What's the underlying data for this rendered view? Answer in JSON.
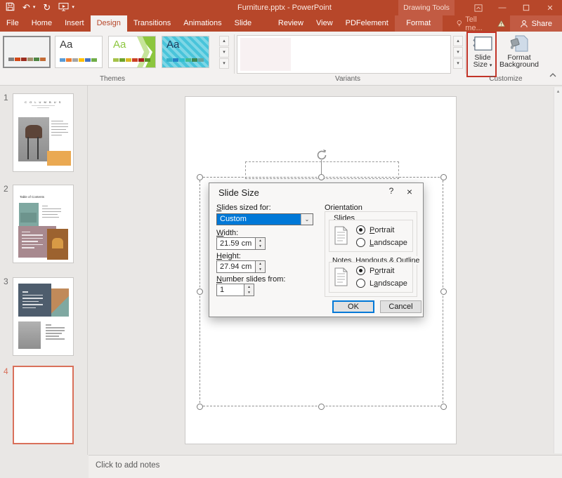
{
  "titlebar": {
    "title": "Furniture.pptx - PowerPoint",
    "contextual_label": "Drawing Tools"
  },
  "icons": {
    "undo_glyph": "↶",
    "redo_glyph": "↻",
    "qat_caret": "▾",
    "min_glyph": "—",
    "close_glyph": "✕",
    "up_arrow": "▴",
    "down_arrow": "▾",
    "chevron_down": "⌄",
    "collapse_chevron": "⌃"
  },
  "tabs": {
    "items": [
      {
        "label": "File"
      },
      {
        "label": "Home"
      },
      {
        "label": "Insert"
      },
      {
        "label": "Design"
      },
      {
        "label": "Transitions"
      },
      {
        "label": "Animations"
      },
      {
        "label": "Slide Show"
      },
      {
        "label": "Review"
      },
      {
        "label": "View"
      },
      {
        "label": "PDFelement"
      }
    ],
    "contextual_tab": "Format",
    "tell_me": "Tell me...",
    "share": "Share"
  },
  "ribbon": {
    "themes": {
      "label": "Themes",
      "aa": "Aa",
      "theme1_swatches": [
        "#7f7f7f",
        "#d34817",
        "#9b2d1f",
        "#a28e6a",
        "#4e8542",
        "#c26b35"
      ],
      "theme2_swatches": [
        "#5b9bd5",
        "#ed7d31",
        "#a5a5a5",
        "#ffc000",
        "#4472c4",
        "#70ad47"
      ],
      "theme3_swatches": [
        "#a5c249",
        "#6fa32b",
        "#d9b926",
        "#cc4125",
        "#a61c1c",
        "#5b8f22"
      ],
      "theme4_swatches": [
        "#35b1c9",
        "#2683c6",
        "#30c0d0",
        "#45ba8f",
        "#3e8853",
        "#6aa4a0"
      ]
    },
    "variants": {
      "label": "Variants"
    },
    "customize": {
      "label": "Customize",
      "slide_size_line1": "Slide",
      "slide_size_line2": "Size",
      "format_background_line1": "Format",
      "format_background_line2": "Background"
    }
  },
  "slide_panel": {
    "slides": [
      {
        "num": "1",
        "title": "C O L U M B U S"
      },
      {
        "num": "2",
        "title": "Table of Contents"
      },
      {
        "num": "3",
        "title": ""
      },
      {
        "num": "4",
        "title": ""
      }
    ]
  },
  "dialog": {
    "title": "Slide Size",
    "help_glyph": "?",
    "close_glyph": "×",
    "sized_for": {
      "pre": "",
      "accel": "S",
      "post": "lides sized for:"
    },
    "sized_for_value": "Custom",
    "width": {
      "pre": "",
      "accel": "W",
      "post": "idth:"
    },
    "width_value": "21.59 cm",
    "height": {
      "pre": "",
      "accel": "H",
      "post": "eight:"
    },
    "height_value": "27.94 cm",
    "number_from": {
      "pre": "",
      "accel": "N",
      "post": "umber slides from:"
    },
    "number_value": "1",
    "orientation": {
      "label": "Orientation",
      "slides_label": "Slides",
      "notes_label": "Notes, Handouts & Outline",
      "slides_portrait": {
        "pre": "",
        "accel": "P",
        "post": "ortrait"
      },
      "slides_landscape": {
        "pre": "",
        "accel": "L",
        "post": "andscape"
      },
      "notes_portrait": {
        "pre": "P",
        "accel": "o",
        "post": "rtrait"
      },
      "notes_landscape": {
        "pre": "L",
        "accel": "a",
        "post": "ndscape"
      }
    },
    "ok": "OK",
    "cancel": "Cancel"
  },
  "notes": {
    "placeholder": "Click to add notes"
  },
  "colors": {
    "titlebar_red": "#b7472a",
    "contextual_red": "#c25b43",
    "tab_active_text": "#b7472a",
    "ribbon_bg": "#f3f1f0",
    "group_label": "#5f5f5f",
    "work_bg": "#e9e7e5",
    "dialog_bg": "#f8f7f6",
    "accent_blue": "#0078d7",
    "annotation_red": "#c23428",
    "selected_thumb_border": "#d9705a",
    "notes_bg": "#f0eeec",
    "tellme_text": "#f3b7a4",
    "warning_fill": "#f3e3c3",
    "thumb_orange": "#eaa952",
    "thumb_mauve": "#a8898f",
    "thumb_slate": "#4e5d6d",
    "thumb_teal": "#7fa8a1",
    "thumb_darkorange": "#9c622f",
    "photo_gray": "#9b9b9b"
  }
}
